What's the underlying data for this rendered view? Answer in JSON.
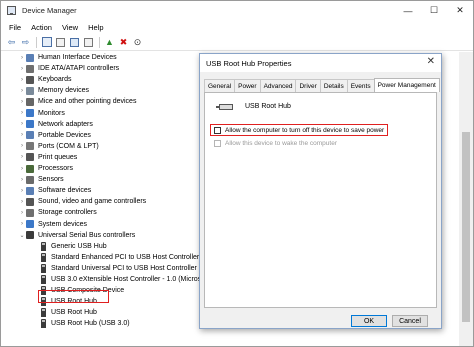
{
  "window": {
    "title": "Device Manager",
    "minimize": "—",
    "maximize": "☐",
    "close": "✕"
  },
  "menu": [
    "File",
    "Action",
    "View",
    "Help"
  ],
  "toolbar": {
    "back": "⇦",
    "forward": "⇨",
    "update": "▲",
    "uninstall": "✖",
    "scan": "⊙"
  },
  "tree": {
    "categories": [
      {
        "label": "Human Interface Devices",
        "icon_color": "#5a7fb5"
      },
      {
        "label": "IDE ATA/ATAPI controllers",
        "icon_color": "#6f6f6f"
      },
      {
        "label": "Keyboards",
        "icon_color": "#555555"
      },
      {
        "label": "Memory devices",
        "icon_color": "#7a8a9a"
      },
      {
        "label": "Mice and other pointing devices",
        "icon_color": "#666666"
      },
      {
        "label": "Monitors",
        "icon_color": "#3c78c8"
      },
      {
        "label": "Network adapters",
        "icon_color": "#3c78c8"
      },
      {
        "label": "Portable Devices",
        "icon_color": "#5a7fb5"
      },
      {
        "label": "Ports (COM & LPT)",
        "icon_color": "#777777"
      },
      {
        "label": "Print queues",
        "icon_color": "#555555"
      },
      {
        "label": "Processors",
        "icon_color": "#4a6a3a"
      },
      {
        "label": "Sensors",
        "icon_color": "#6a6a6a"
      },
      {
        "label": "Software devices",
        "icon_color": "#5a7fb5"
      },
      {
        "label": "Sound, video and game controllers",
        "icon_color": "#555555"
      },
      {
        "label": "Storage controllers",
        "icon_color": "#6f6f6f"
      },
      {
        "label": "System devices",
        "icon_color": "#3c78c8"
      },
      {
        "label": "Universal Serial Bus controllers",
        "icon_color": "#3b3b3b"
      }
    ],
    "usb_children": [
      "Generic USB Hub",
      "Standard Enhanced PCI to USB Host Controller",
      "Standard Universal PCI to USB Host Controller",
      "USB 3.0 eXtensible Host Controller - 1.0 (Microsoft)",
      "USB Composite Device",
      "USB Root Hub",
      "USB Root Hub",
      "USB Root Hub (USB 3.0)"
    ],
    "collapsed_glyph": "›",
    "expanded_glyph": "⌄"
  },
  "dialog": {
    "title": "USB Root Hub Properties",
    "close": "✕",
    "tabs": [
      "General",
      "Power",
      "Advanced",
      "Driver",
      "Details",
      "Events",
      "Power Management"
    ],
    "active_tab": "Power Management",
    "device_name": "USB Root Hub",
    "options": [
      {
        "label": "Allow the computer to turn off this device to save power",
        "checked": false,
        "enabled": true
      },
      {
        "label": "Allow this device to wake the computer",
        "checked": false,
        "enabled": false
      }
    ],
    "ok_label": "OK",
    "cancel_label": "Cancel"
  },
  "colors": {
    "highlight": "#e02020",
    "accent": "#0078d7"
  }
}
